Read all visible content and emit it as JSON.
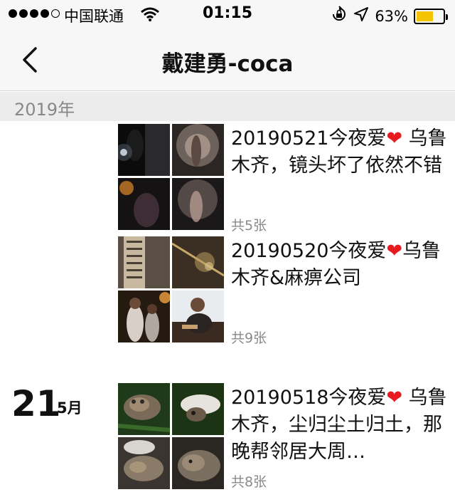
{
  "status_bar": {
    "carrier": "中国联通",
    "time": "01:15",
    "battery": "63%",
    "battery_level": 0.63,
    "battery_color": "#f5c400"
  },
  "nav": {
    "title": "戴建勇-coca",
    "back_icon": "chevron-left-icon"
  },
  "timeline": {
    "year": "2019年",
    "entries": [
      {
        "title_text": "20190521今夜爱",
        "title_suffix": " 乌鲁木齐，镜头坏了依然不错",
        "count": "共5张"
      },
      {
        "title_text": "20190520今夜爱",
        "title_suffix": "乌鲁木齐&麻痹公司",
        "count": "共9张"
      },
      {
        "day": "21",
        "month": "5月",
        "title_text": "20190518今夜爱",
        "title_suffix": " 乌鲁木齐，尘归尘土归土，那晚帮邻居大周…",
        "count": "共8张"
      }
    ]
  },
  "colors": {
    "heart": "#e8191f",
    "header_bg": "#f7f7f7",
    "year_bg": "#ececec"
  }
}
